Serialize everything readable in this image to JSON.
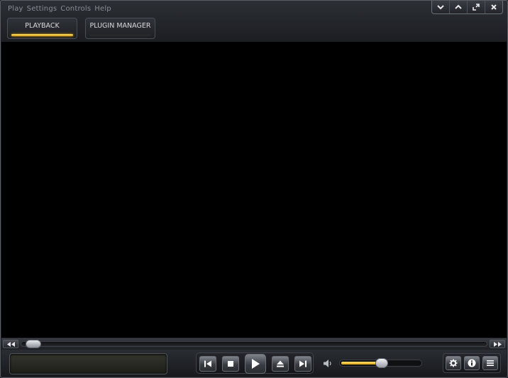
{
  "menu": [
    "Play",
    "Settings",
    "Controls",
    "Help"
  ],
  "window_controls": [
    {
      "name": "minimize",
      "icon": "chevron-down-icon"
    },
    {
      "name": "restore",
      "icon": "chevron-up-icon"
    },
    {
      "name": "fullscreen",
      "icon": "resize-icon"
    },
    {
      "name": "close",
      "icon": "close-icon"
    }
  ],
  "tabs": [
    {
      "label": "PLAYBACK",
      "active": true
    },
    {
      "label": "PLUGIN MANAGER",
      "active": false
    }
  ],
  "seek": {
    "position": 0.0
  },
  "transport": [
    {
      "name": "previous",
      "icon": "skip-previous-icon"
    },
    {
      "name": "stop",
      "icon": "stop-icon"
    },
    {
      "name": "play",
      "icon": "play-icon"
    },
    {
      "name": "eject",
      "icon": "eject-icon"
    },
    {
      "name": "next",
      "icon": "skip-next-icon"
    }
  ],
  "volume": {
    "level": 0.5,
    "icon": "speaker-icon"
  },
  "tools": [
    {
      "name": "settings",
      "icon": "gear-icon"
    },
    {
      "name": "info",
      "icon": "info-icon"
    },
    {
      "name": "playlist",
      "icon": "list-icon"
    }
  ],
  "colors": {
    "accent": "#f5c518",
    "video_bg": "#000000",
    "chrome": "#1b1d21"
  }
}
